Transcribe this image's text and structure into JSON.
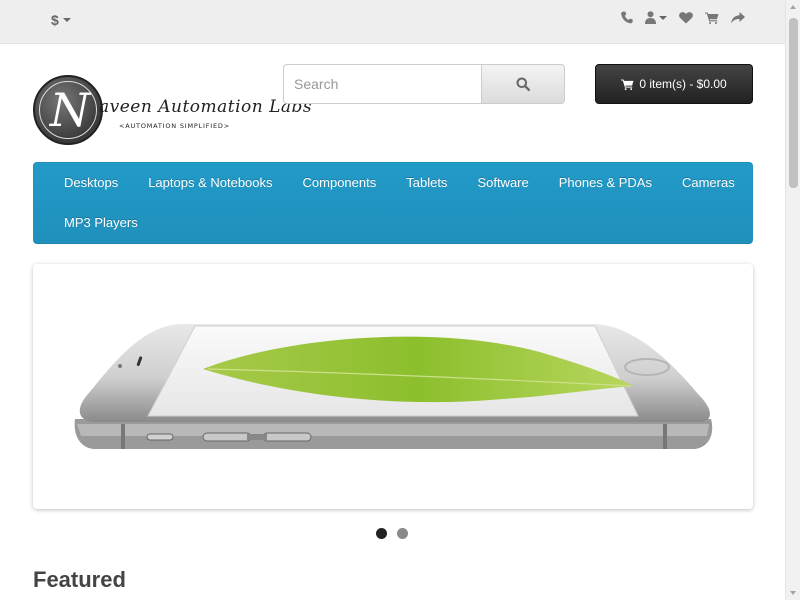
{
  "topbar": {
    "currency_symbol": "$",
    "icons": [
      "phone-icon",
      "user-icon",
      "heart-icon",
      "shopping-cart-icon",
      "share-icon"
    ]
  },
  "logo": {
    "letter": "N",
    "name": "aveen Automation Labs",
    "tagline": "<AUTOMATION SIMPLIFIED>"
  },
  "search": {
    "placeholder": "Search",
    "value": "",
    "button_icon": "search-icon"
  },
  "cart": {
    "label": "0 item(s) - $0.00",
    "icon": "shopping-cart-icon"
  },
  "menu": {
    "items": [
      {
        "label": "Desktops"
      },
      {
        "label": "Laptops & Notebooks"
      },
      {
        "label": "Components"
      },
      {
        "label": "Tablets"
      },
      {
        "label": "Software"
      },
      {
        "label": "Phones & PDAs"
      },
      {
        "label": "Cameras"
      },
      {
        "label": "MP3 Players"
      }
    ]
  },
  "slideshow": {
    "pagination_count": 2,
    "active_index": 0
  },
  "featured": {
    "heading": "Featured"
  },
  "colors": {
    "menu_blue": "#229ac8",
    "cart_dark": "#222222",
    "topbar_bg": "#eeeeee"
  }
}
